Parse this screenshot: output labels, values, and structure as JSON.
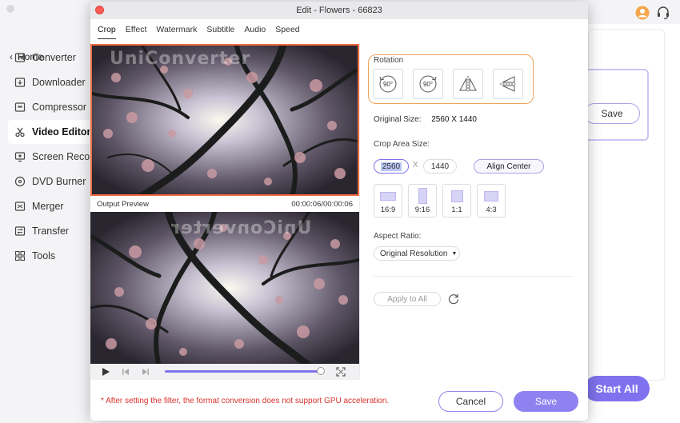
{
  "app": {
    "home_label": "Home",
    "nav": [
      {
        "label": "Converter",
        "icon": "converter-icon"
      },
      {
        "label": "Downloader",
        "icon": "download-icon"
      },
      {
        "label": "Compressor",
        "icon": "compress-icon"
      },
      {
        "label": "Video Editor",
        "icon": "scissors-icon",
        "active": true
      },
      {
        "label": "Screen Recorder",
        "icon": "screen-record-icon"
      },
      {
        "label": "DVD Burner",
        "icon": "disc-icon"
      },
      {
        "label": "Merger",
        "icon": "merge-icon"
      },
      {
        "label": "Transfer",
        "icon": "transfer-icon"
      },
      {
        "label": "Tools",
        "icon": "grid-icon"
      }
    ],
    "save_label": "Save",
    "start_all_label": "Start All",
    "accent": "#7f72ee"
  },
  "dialog": {
    "title": "Edit - Flowers - 66823",
    "tabs": [
      "Crop",
      "Effect",
      "Watermark",
      "Subtitle",
      "Audio",
      "Speed"
    ],
    "active_tab": "Crop",
    "watermark_text": "UniConverter",
    "output_preview_label": "Output Preview",
    "time_display": "00:00:06/00:00:06",
    "playback_progress": 1.0,
    "rotation_label": "Rotation",
    "rotate_ccw_label": "90°",
    "rotate_cw_label": "90°",
    "original_size_label": "Original Size:",
    "original_size_value": "2560 X 1440",
    "crop_area_label": "Crop Area Size:",
    "crop_width": "2560",
    "crop_sep": "X",
    "crop_height": "1440",
    "align_center_label": "Align Center",
    "ratios": [
      "16:9",
      "9:16",
      "1:1",
      "4:3"
    ],
    "aspect_ratio_label": "Aspect Ratio:",
    "aspect_ratio_value": "Original Resolution",
    "apply_all_label": "Apply to All",
    "footer_note": "* After setting the filter, the format conversion does not support GPU acceleration.",
    "cancel_label": "Cancel",
    "save_label": "Save",
    "highlight_color": "#f36c3f"
  }
}
